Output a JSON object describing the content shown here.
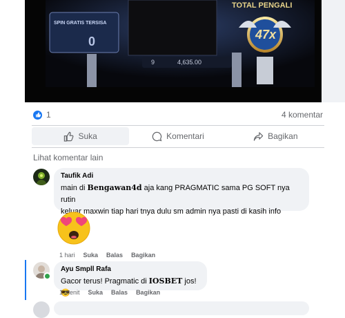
{
  "video": {
    "spin_label": "SPIN GRATIS TERSISA",
    "spin_value": "0",
    "total_label": "TOTAL PENGALI",
    "multiplier": "47x",
    "bet_value": "9",
    "win_value": "4,635.00"
  },
  "stats": {
    "likes": "1",
    "comments": "4 komentar"
  },
  "actions": {
    "like": "Suka",
    "comment": "Komentari",
    "share": "Bagikan"
  },
  "more_comments": "Lihat komentar lain",
  "comments": [
    {
      "name": "Taufik Adi",
      "line1_pre": "main di ",
      "line1_bold": "Bengawan4d",
      "line1_post": " aja kang PRAGMATIC sama PG SOFT nya rutin",
      "line2": "keluar maxwin tiap hari tnya dulu sm admin nya pasti di kasih info",
      "time": "1 hari",
      "like": "Suka",
      "reply": "Balas",
      "share": "Bagikan"
    },
    {
      "name": "Ayu Smpll Rafa",
      "text_pre": "Gacor terus! Pragmatic di ",
      "text_bold": "IOSBET",
      "text_post": " jos! ",
      "emoji": "😎",
      "time": "1 menit",
      "like": "Suka",
      "reply": "Balas",
      "share": "Bagikan"
    }
  ],
  "colors": {
    "accent": "#1877f2",
    "bubble": "#f0f2f5",
    "muted": "#65676b",
    "online": "#31a24c"
  }
}
